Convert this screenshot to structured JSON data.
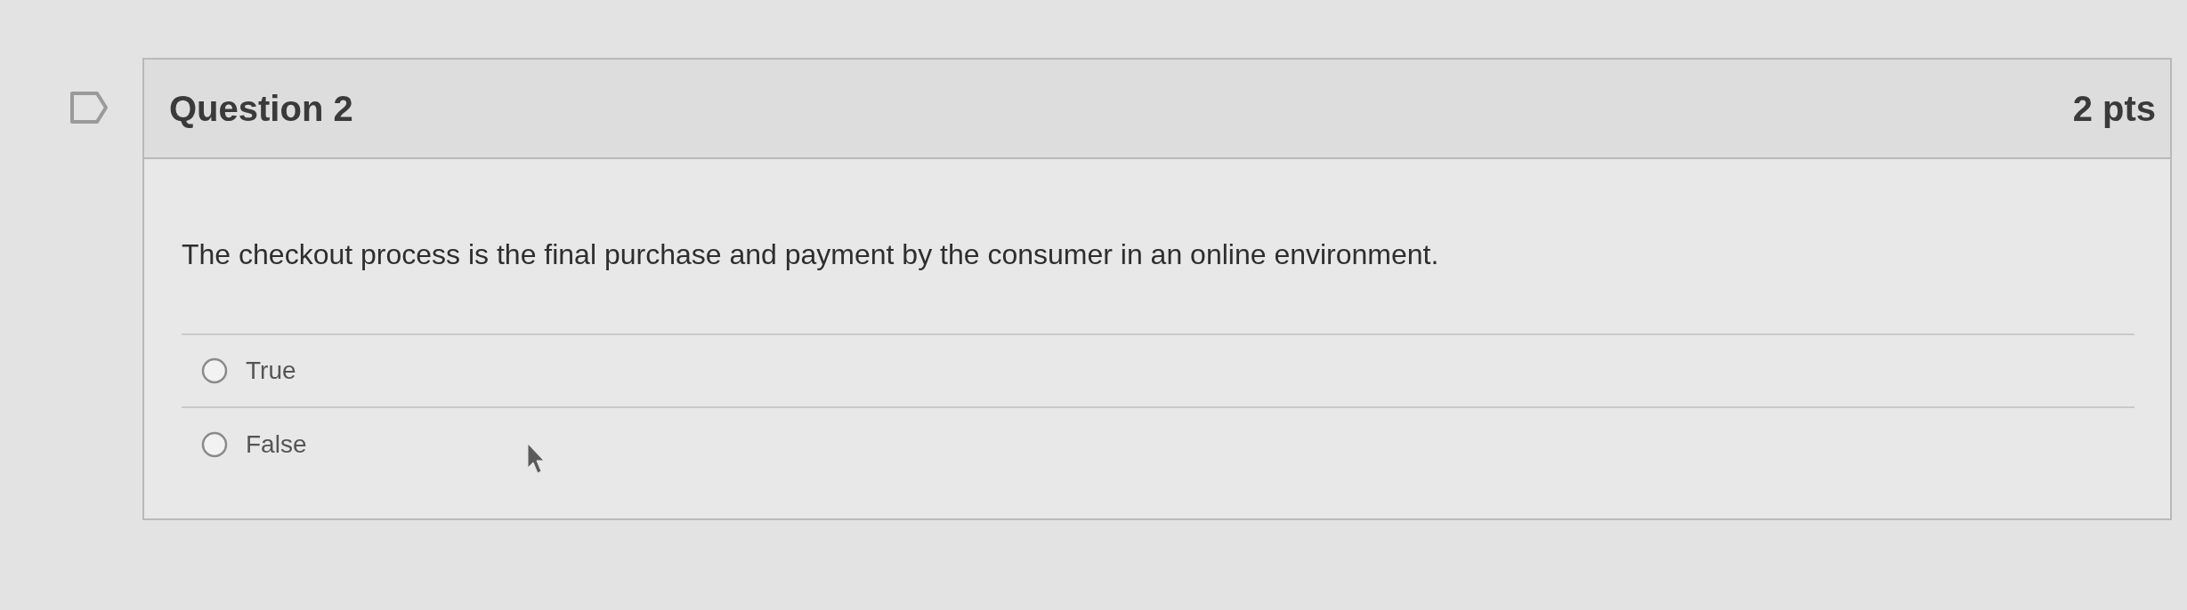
{
  "question": {
    "title": "Question 2",
    "points": "2 pts",
    "text": "The checkout process is the final purchase and payment by the consumer in an online environment.",
    "answers": [
      {
        "label": "True",
        "selected": false
      },
      {
        "label": "False",
        "selected": false
      }
    ]
  }
}
